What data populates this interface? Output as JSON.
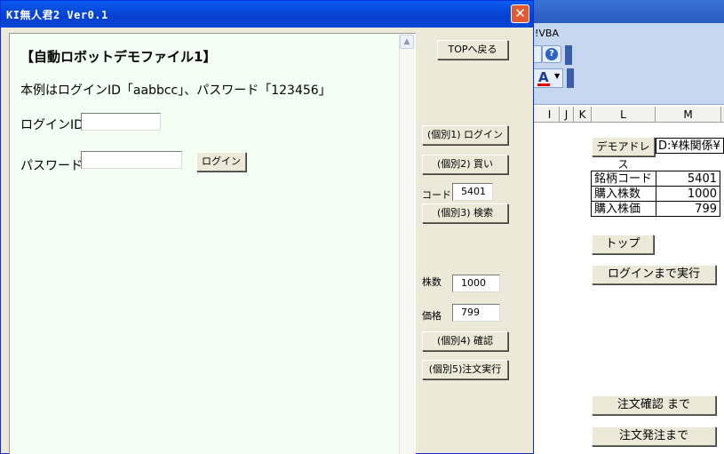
{
  "window": {
    "title": "KI無人君2 Ver0.1",
    "close_glyph": "✕"
  },
  "browser": {
    "heading": "【自動ロボットデモファイル1】",
    "description": "本例はログインID「aabbcc」、パスワード「123456」",
    "login_id_label": "ログインID",
    "login_id_value": "",
    "password_label": "パスワード",
    "password_value": "",
    "login_button": "ログイン",
    "scroll_up_glyph": "▲"
  },
  "controls": {
    "top_button": "TOPへ戻る",
    "step1_button": "(個別1) ログイン",
    "step2_button": "(個別2) 買い",
    "code_label": "コード",
    "code_value": "5401",
    "step3_button": "(個別3) 検索",
    "shares_label": "株数",
    "shares_value": "1000",
    "price_label": "価格",
    "price_value": "799",
    "step4_button": "(個別4) 確認",
    "step5_button": "(個別5)注文実行"
  },
  "excel": {
    "menu_fragment": "!VBA",
    "help_icon": "question-icon",
    "font_color_glyph": "A",
    "columns": [
      "I",
      "J",
      "K",
      "L",
      "M"
    ],
    "demo_address_button": "デモアドレス",
    "demo_address_value": "D:¥株関係¥",
    "table": [
      {
        "label": "銘柄コード",
        "value": "5401"
      },
      {
        "label": "購入株数",
        "value": "1000"
      },
      {
        "label": "購入株価",
        "value": "799"
      }
    ],
    "top_button": "トップ",
    "run_login_button": "ログインまで実行",
    "run_confirm_button": "注文確認 まで",
    "run_order_button": "注文発注まで"
  },
  "colors": {
    "title_bar": "#0740cf",
    "panel_bg": "#f2fff2",
    "close": "#e05a34"
  }
}
